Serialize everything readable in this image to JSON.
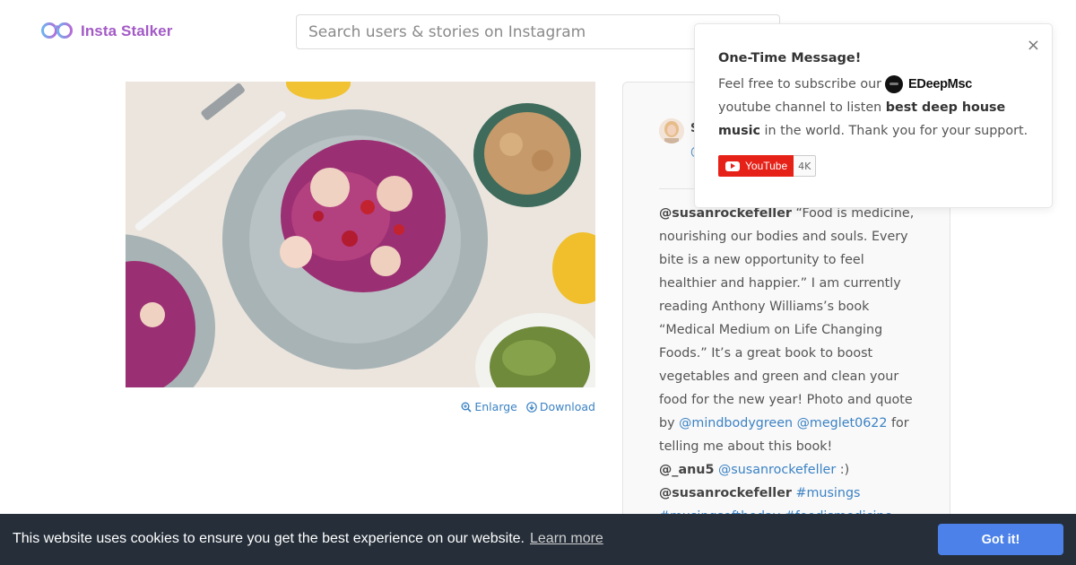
{
  "header": {
    "logo_icon": "infinity-glasses-icon",
    "logo_text": "Insta Stalker",
    "search_placeholder": "Search users & stories on Instagram"
  },
  "photo": {
    "alt": "",
    "actions": {
      "enlarge": "Enlarge",
      "download": "Download"
    }
  },
  "post": {
    "author_initial": "S",
    "author_handle_stub": "@",
    "caption": {
      "author": "@susanrockefeller",
      "text_1": " “Food is medicine, nourishing our bodies and souls. Every bite is a new opportunity to feel healthier and happier.” I am currently reading Anthony Williams’s book “Medical Medium on Life Changing Foods.” It’s a great book to boost vegetables and green and clean your food for the new year! Photo and quote by ",
      "link_1": "@mindbodygreen",
      "link_2": "@meglet0622",
      "text_2": " for telling me about this book!",
      "commenter": "@_anu5",
      "link_3": "@susanrockefeller",
      "text_3": " :)",
      "author_2": "@susanrockefeller",
      "tag_1": "#musings",
      "tag_2": "#musingsoftheday",
      "tag_3": "#foodismedicine"
    }
  },
  "popup": {
    "title": "One-Time Message!",
    "text_1": "Feel free to subscribe our",
    "brand": "EDeepMsc",
    "text_2": "youtube channel to listen",
    "bold": "best deep house music",
    "text_3": "in the world. Thank you for your support.",
    "close": "×",
    "youtube_label": "YouTube",
    "youtube_count": "4K"
  },
  "cookie": {
    "message": "This website uses cookies to ensure you get the best experience on our website.",
    "learn_more": "Learn more",
    "button": "Got it!"
  },
  "colors": {
    "brand_purple": "#a35ac6",
    "link_blue": "#3b82c4",
    "cookie_bg": "#252e39",
    "cookie_button": "#4b81e8",
    "youtube_red": "#e62117"
  }
}
